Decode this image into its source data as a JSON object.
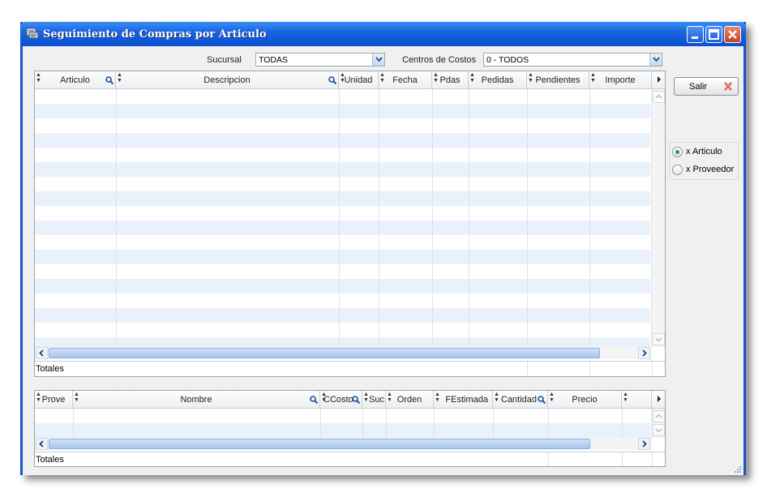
{
  "window": {
    "title": "Seguimiento de Compras por Articulo",
    "titlebar_color": "#1a65e0"
  },
  "filters": {
    "sucursal_label": "Sucursal",
    "sucursal_value": "TODAS",
    "centros_label": "Centros de Costos",
    "centros_value": "0 - TODOS"
  },
  "top_grid": {
    "columns": [
      "Articulo",
      "Descripcion",
      "Unidad",
      "Fecha",
      "Pdas",
      "Pedidas",
      "Pendientes",
      "Importe"
    ],
    "rows": [],
    "totals_label": "Totales",
    "row_stripe_color": "#e9f1fb"
  },
  "bottom_grid": {
    "columns": [
      "Prove",
      "Nombre",
      "CCosto",
      "Suc",
      "Orden",
      "FEstimada",
      "Cantidad",
      "Precio"
    ],
    "rows": [],
    "totals_label": "Totales"
  },
  "actions": {
    "salir_label": "Salir"
  },
  "view_mode": {
    "options": [
      "x Articulo",
      "x Proveedor"
    ],
    "selected": "x Articulo"
  }
}
